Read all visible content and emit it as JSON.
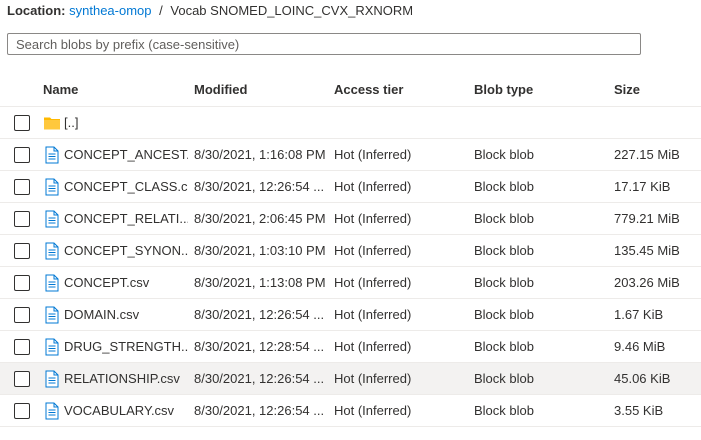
{
  "location": {
    "label": "Location:",
    "container": "synthea-omop",
    "separator": "/",
    "path": "Vocab SNOMED_LOINC_CVX_RXNORM"
  },
  "search": {
    "placeholder": "Search blobs by prefix (case-sensitive)",
    "value": ""
  },
  "columns": {
    "name": "Name",
    "modified": "Modified",
    "tier": "Access tier",
    "type": "Blob type",
    "size": "Size"
  },
  "parent_row": {
    "name": "[..]",
    "icon": "folder-icon"
  },
  "rows": [
    {
      "name": "CONCEPT_ANCEST...",
      "modified": "8/30/2021, 1:16:08 PM",
      "tier": "Hot (Inferred)",
      "type": "Block blob",
      "size": "227.15 MiB"
    },
    {
      "name": "CONCEPT_CLASS.csv",
      "modified": "8/30/2021, 12:26:54 ...",
      "tier": "Hot (Inferred)",
      "type": "Block blob",
      "size": "17.17 KiB"
    },
    {
      "name": "CONCEPT_RELATI...",
      "modified": "8/30/2021, 2:06:45 PM",
      "tier": "Hot (Inferred)",
      "type": "Block blob",
      "size": "779.21 MiB"
    },
    {
      "name": "CONCEPT_SYNON...",
      "modified": "8/30/2021, 1:03:10 PM",
      "tier": "Hot (Inferred)",
      "type": "Block blob",
      "size": "135.45 MiB"
    },
    {
      "name": "CONCEPT.csv",
      "modified": "8/30/2021, 1:13:08 PM",
      "tier": "Hot (Inferred)",
      "type": "Block blob",
      "size": "203.26 MiB"
    },
    {
      "name": "DOMAIN.csv",
      "modified": "8/30/2021, 12:26:54 ...",
      "tier": "Hot (Inferred)",
      "type": "Block blob",
      "size": "1.67 KiB"
    },
    {
      "name": "DRUG_STRENGTH....",
      "modified": "8/30/2021, 12:28:54 ...",
      "tier": "Hot (Inferred)",
      "type": "Block blob",
      "size": "9.46 MiB"
    },
    {
      "name": "RELATIONSHIP.csv",
      "modified": "8/30/2021, 12:26:54 ...",
      "tier": "Hot (Inferred)",
      "type": "Block blob",
      "size": "45.06 KiB"
    },
    {
      "name": "VOCABULARY.csv",
      "modified": "8/30/2021, 12:26:54 ...",
      "tier": "Hot (Inferred)",
      "type": "Block blob",
      "size": "3.55 KiB"
    }
  ],
  "highlighted_row": 7,
  "colors": {
    "link": "#0078d4",
    "folder": "#ffb900",
    "file": "#0078d4",
    "row_hover": "#f3f2f1"
  }
}
